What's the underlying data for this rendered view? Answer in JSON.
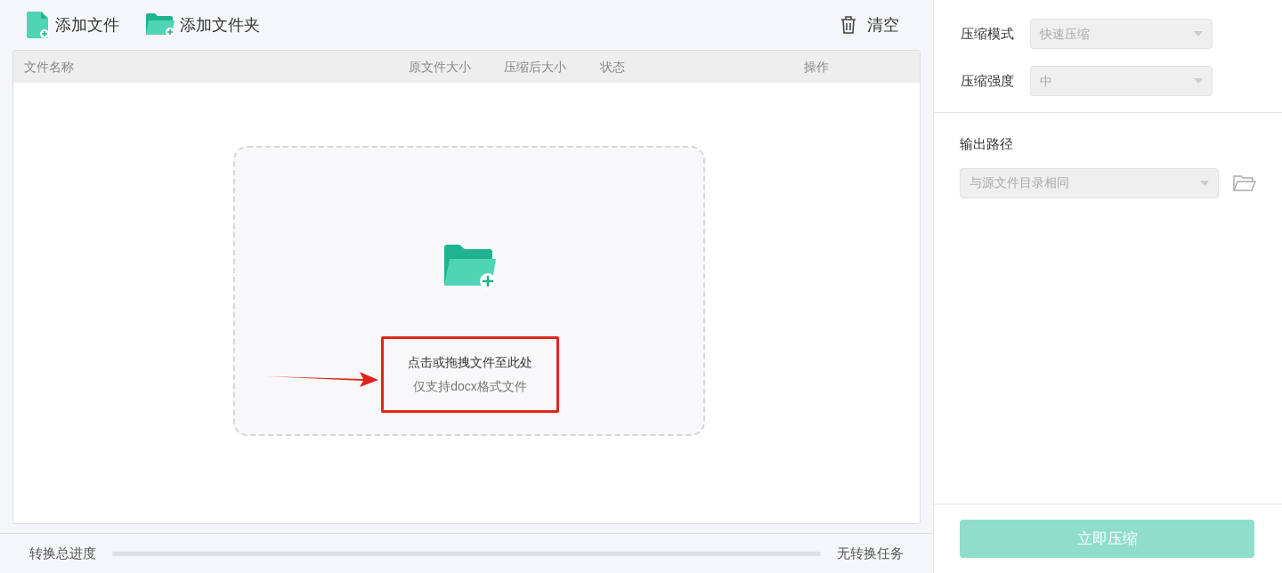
{
  "toolbar": {
    "buttons": [
      {
        "kind": "file",
        "label": "添加文件"
      },
      {
        "kind": "folder",
        "label": "添加文件夹"
      }
    ],
    "clear_button": {
      "label": "清空"
    }
  },
  "table": {
    "columns": [
      "文件名称",
      "原文件大小",
      "压缩后大小",
      "状态",
      "操作"
    ]
  },
  "dropzone": {
    "title": "点击或拖拽文件至此处",
    "hint": "仅支持docx格式文件"
  },
  "progress": {
    "label": "转换总进度",
    "level": 0,
    "status": "无转换任务"
  },
  "settings": {
    "fields": [
      {
        "label": "压缩模式",
        "value": "快速压缩"
      },
      {
        "label": "压缩强度",
        "value": "中"
      }
    ],
    "output_path": {
      "label": "输出路径",
      "value": "与源文件目录相同"
    }
  },
  "submit_button": {
    "label": "立即压缩",
    "disabled": true
  }
}
